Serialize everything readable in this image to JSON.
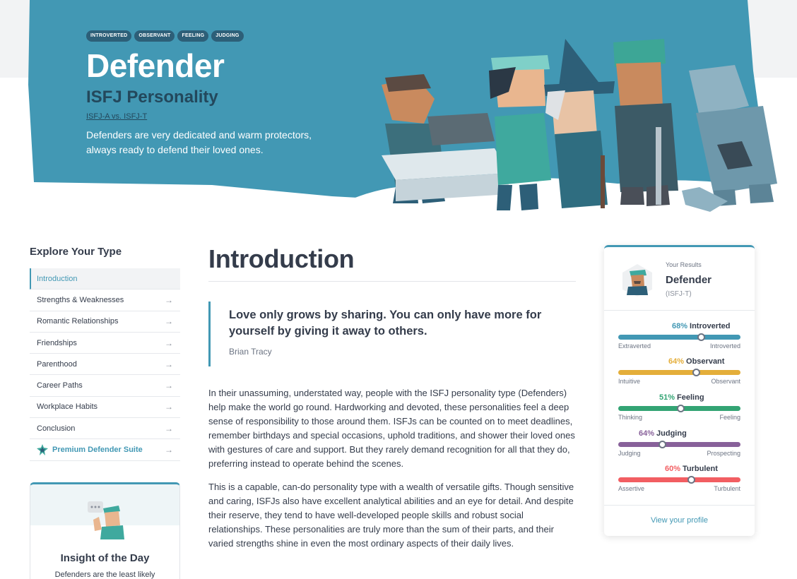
{
  "colors": {
    "hero_blue": "#4298b4",
    "accent_teal": "#4298b4",
    "introverted": "#4298b4",
    "observant": "#e4ae3a",
    "feeling": "#33a474",
    "judging": "#88619a",
    "turbulent": "#f25e62"
  },
  "hero": {
    "tags": [
      "INTROVERTED",
      "OBSERVANT",
      "FEELING",
      "JUDGING"
    ],
    "title": "Defender",
    "subtitle": "ISFJ Personality",
    "variants_link": "ISFJ-A vs. ISFJ-T",
    "description": "Defenders are very dedicated and warm protectors, always ready to defend their loved ones."
  },
  "sidebar": {
    "title": "Explore Your Type",
    "items": [
      {
        "label": "Introduction",
        "active": true
      },
      {
        "label": "Strengths & Weaknesses"
      },
      {
        "label": "Romantic Relationships"
      },
      {
        "label": "Friendships"
      },
      {
        "label": "Parenthood"
      },
      {
        "label": "Career Paths"
      },
      {
        "label": "Workplace Habits"
      },
      {
        "label": "Conclusion"
      }
    ],
    "premium_label": "Premium Defender Suite",
    "arrow_glyph": "→",
    "insight_title": "Insight of the Day",
    "insight_text": "Defenders are the least likely"
  },
  "main": {
    "heading": "Introduction",
    "quote": "Love only grows by sharing. You can only have more for yourself by giving it away to others.",
    "quote_author": "Brian Tracy",
    "paragraphs": [
      "In their unassuming, understated way, people with the ISFJ personality type (Defenders) help make the world go round. Hardworking and devoted, these personalities feel a deep sense of responsibility to those around them. ISFJs can be counted on to meet deadlines, remember birthdays and special occasions, uphold traditions, and shower their loved ones with gestures of care and support. But they rarely demand recognition for all that they do, preferring instead to operate behind the scenes.",
      "This is a capable, can-do personality type with a wealth of versatile gifts. Though sensitive and caring, ISFJs also have excellent analytical abilities and an eye for detail. And despite their reserve, they tend to have well-developed people skills and robust social relationships. These personalities are truly more than the sum of their parts, and their varied strengths shine in even the most ordinary aspects of their daily lives."
    ]
  },
  "results": {
    "label": "Your Results",
    "type": "Defender",
    "code": "(ISFJ-T)",
    "traits": [
      {
        "pct_text": "68%",
        "name": "Introverted",
        "left": "Extraverted",
        "right": "Introverted",
        "value": 0.68,
        "color": "#4298b4"
      },
      {
        "pct_text": "64%",
        "name": "Observant",
        "left": "Intuitive",
        "right": "Observant",
        "value": 0.64,
        "color": "#e4ae3a"
      },
      {
        "pct_text": "51%",
        "name": "Feeling",
        "left": "Thinking",
        "right": "Feeling",
        "value": 0.51,
        "color": "#33a474"
      },
      {
        "pct_text": "64%",
        "name": "Judging",
        "left": "Judging",
        "right": "Prospecting",
        "value": 0.36,
        "color": "#88619a"
      },
      {
        "pct_text": "60%",
        "name": "Turbulent",
        "left": "Assertive",
        "right": "Turbulent",
        "value": 0.6,
        "color": "#f25e62"
      }
    ],
    "link": "View your profile"
  }
}
